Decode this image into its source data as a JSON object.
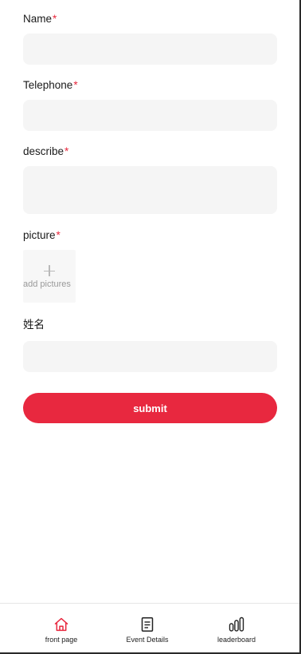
{
  "form": {
    "name_label": "Name",
    "tel_label": "Telephone",
    "describe_label": "describe",
    "picture_label": "picture",
    "required_mark": "*",
    "add_pictures": "add pictures",
    "chinese_name_label": "姓名",
    "submit_label": "submit",
    "name_value": "",
    "tel_value": "",
    "describe_value": "",
    "chinese_name_value": ""
  },
  "tabbar": {
    "home_label": "front page",
    "details_label": "Event Details",
    "board_label": "leaderboard",
    "active_color": "#e8283f"
  },
  "icons": {
    "home": "home-icon",
    "details": "document-icon",
    "board": "bar-chart-icon",
    "add": "plus-icon"
  },
  "colors": {
    "accent": "#e8283f",
    "required": "#e8283d",
    "input_bg": "#f5f5f5"
  }
}
